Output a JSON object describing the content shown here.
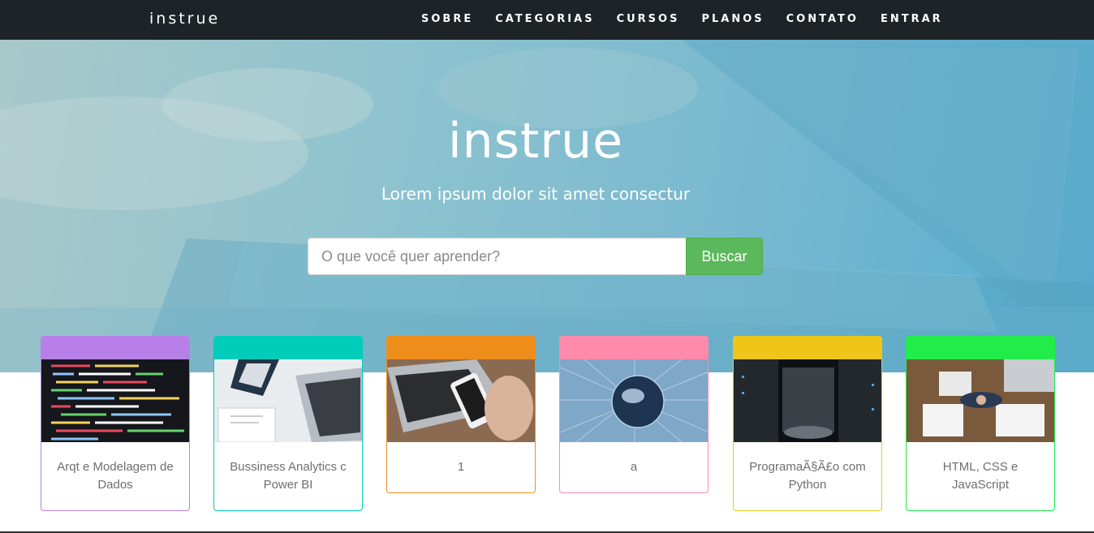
{
  "nav": {
    "brand": "instrue",
    "links": [
      "SOBRE",
      "CATEGORIAS",
      "CURSOS",
      "PLANOS",
      "CONTATO",
      "ENTRAR"
    ]
  },
  "hero": {
    "title": "instrue",
    "subtitle": "Lorem ipsum dolor sit amet consectur",
    "search_placeholder": "O que você quer aprender?",
    "search_button": "Buscar"
  },
  "colors": {
    "navbar": "#1d2326",
    "hero_accent": "#56aed3",
    "search_button": "#5cb85c"
  },
  "cards": [
    {
      "title": "Arqt e Modelagem de Dados",
      "color": "#b77fe8",
      "image": "code-screen-image"
    },
    {
      "title": "Bussiness Analytics c Power BI",
      "color": "#00cdb9",
      "image": "laptop-desk-image"
    },
    {
      "title": "1",
      "color": "#ef8d1b",
      "image": "phone-keyboard-image"
    },
    {
      "title": "a",
      "color": "#ff8aac",
      "image": "globe-network-image"
    },
    {
      "title": "ProgramaÃ§Ã£o com Python",
      "color": "#eec61a",
      "image": "server-room-image"
    },
    {
      "title": "HTML, CSS e JavaScript",
      "color": "#22ec4a",
      "image": "business-meeting-image"
    }
  ]
}
